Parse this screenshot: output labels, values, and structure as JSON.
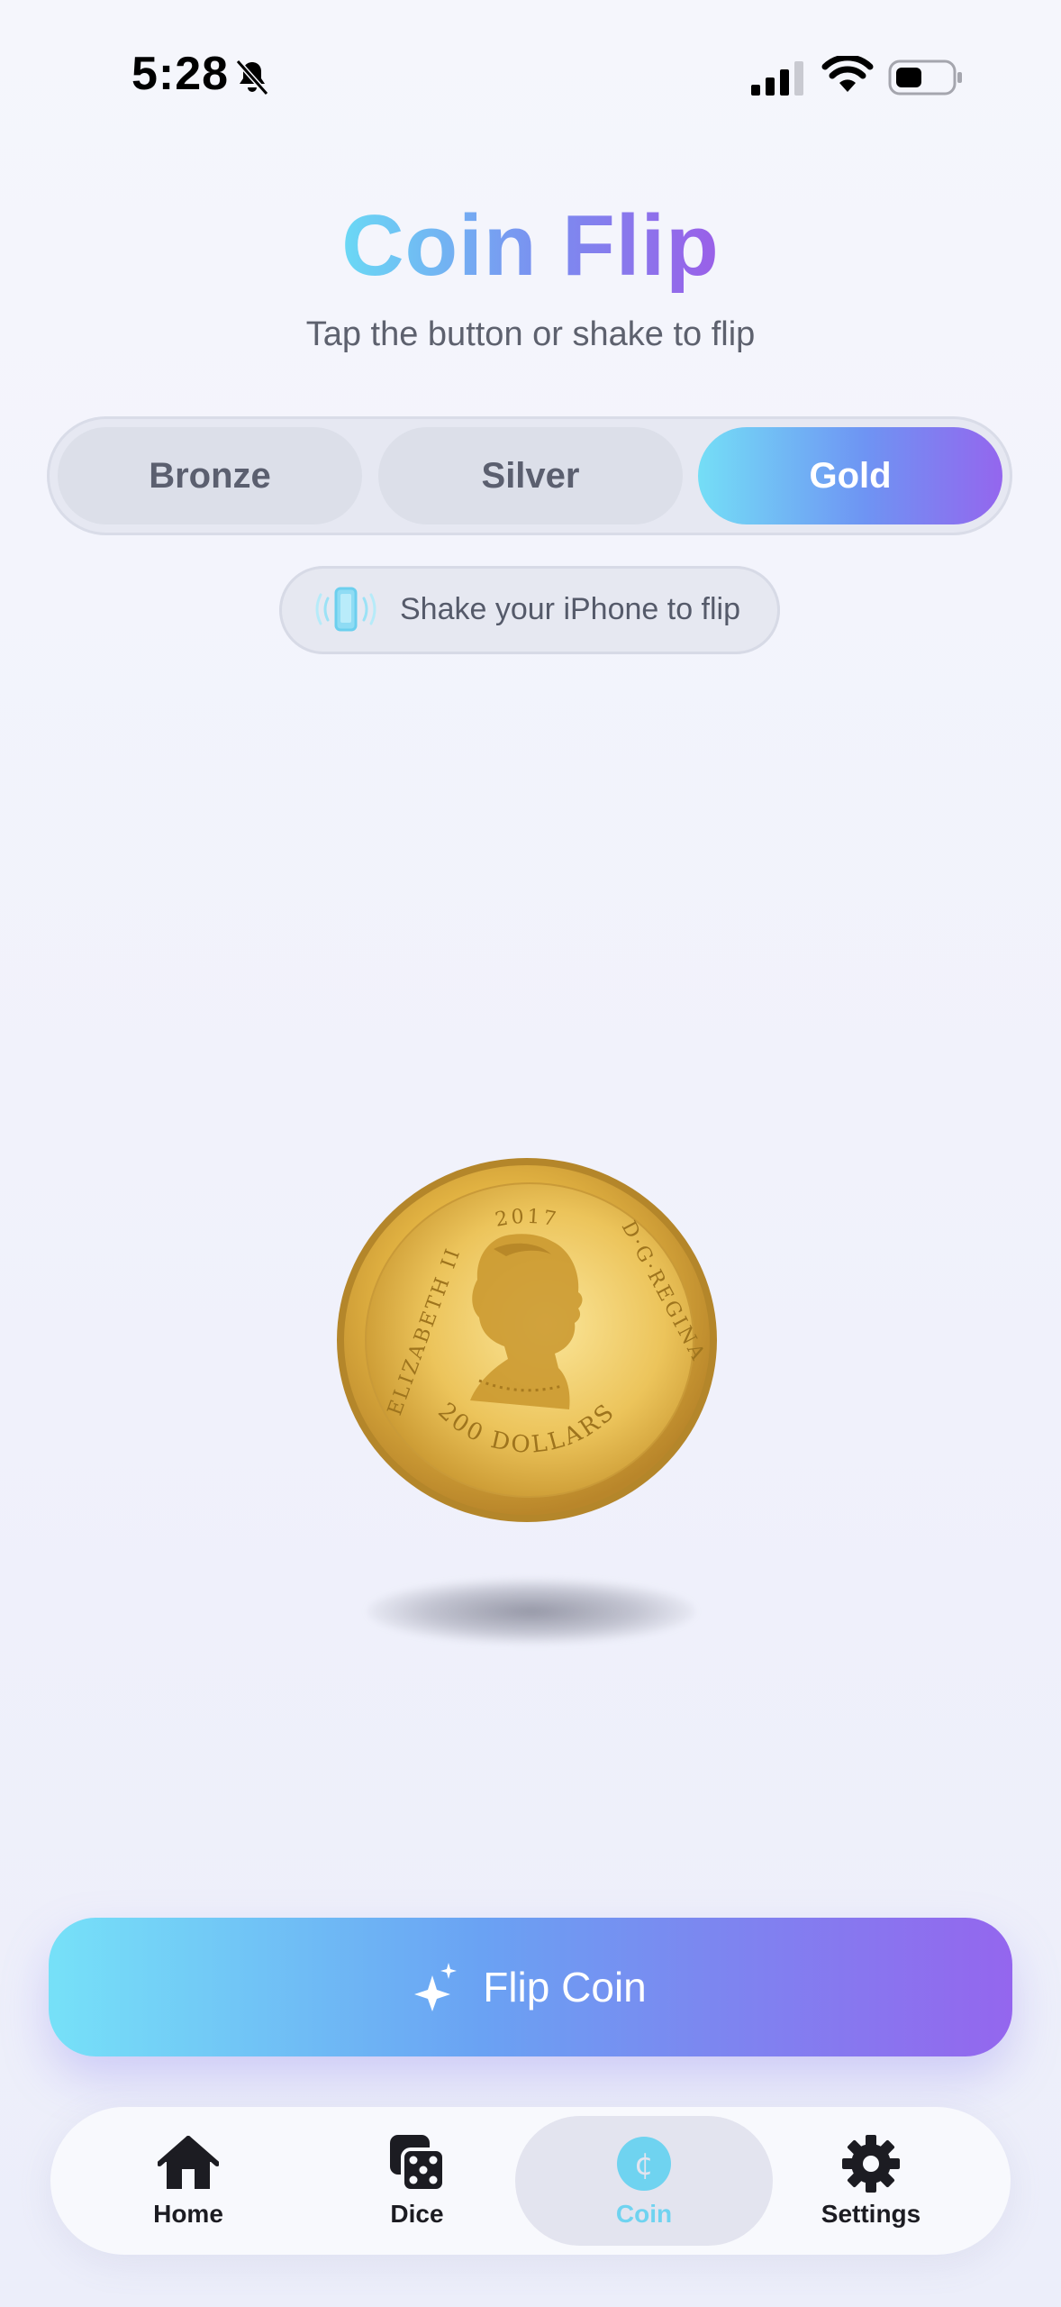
{
  "status_bar": {
    "time": "5:28",
    "icons": [
      "bell-slash-icon",
      "cellular-signal-icon",
      "wifi-icon",
      "battery-icon"
    ]
  },
  "header": {
    "title": "Coin Flip",
    "subtitle": "Tap the button or shake to flip"
  },
  "coin_type": {
    "options": [
      "Bronze",
      "Silver",
      "Gold"
    ],
    "selected": "Gold"
  },
  "shake_hint": {
    "icon": "phone-vibrate-icon",
    "text": "Shake your iPhone to flip"
  },
  "coin": {
    "year": "2017",
    "left_legend": "ELIZABETH II",
    "right_legend": "D·G·REGINA",
    "denomination": "200 DOLLARS"
  },
  "flip_button": {
    "icon": "sparkles-icon",
    "label": "Flip Coin"
  },
  "tab_bar": {
    "items": [
      {
        "label": "Home",
        "icon": "house-icon"
      },
      {
        "label": "Dice",
        "icon": "dice-icon"
      },
      {
        "label": "Coin",
        "icon": "cent-coin-icon",
        "selected": true
      },
      {
        "label": "Settings",
        "icon": "gear-icon"
      }
    ]
  },
  "colors": {
    "accent_start": "#74def6",
    "accent_mid": "#6e94f3",
    "accent_end": "#9466ee",
    "selected_tab_label": "#6fd3f0",
    "coin_gold": "#d9a93a"
  }
}
